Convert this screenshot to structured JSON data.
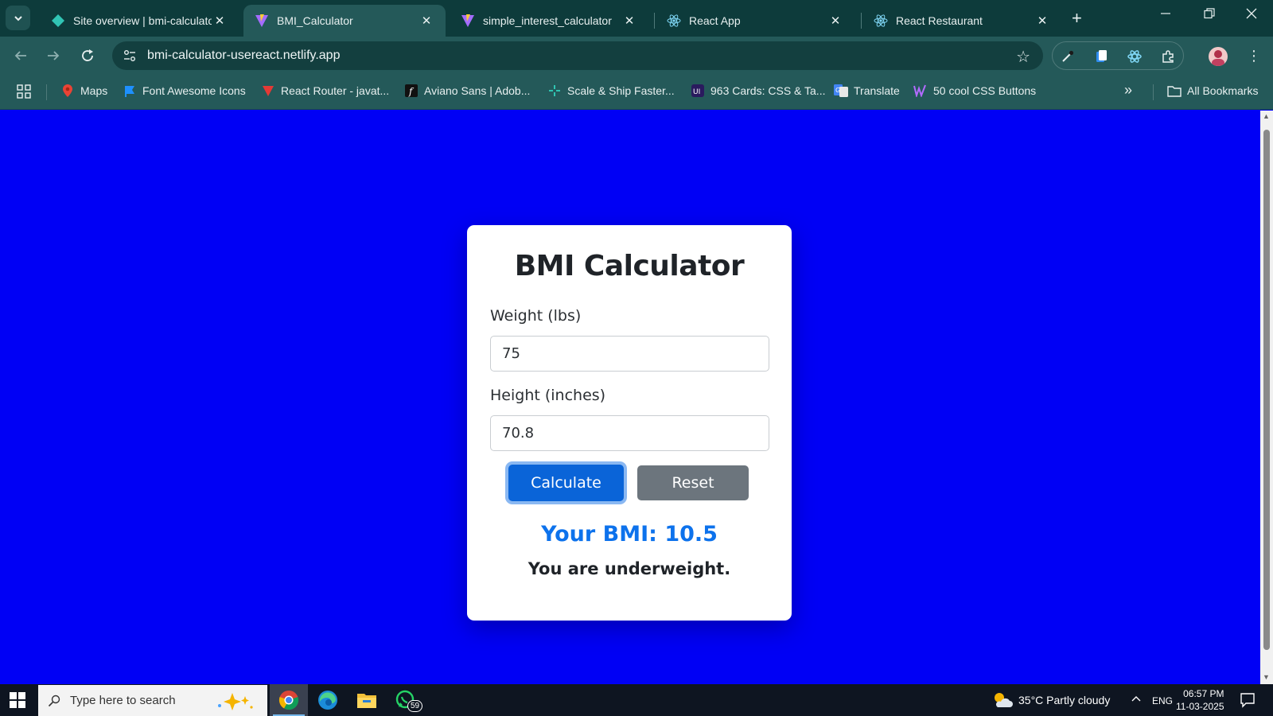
{
  "browser": {
    "tabs": [
      {
        "title": "Site overview | bmi-calculato",
        "icon": "netlify-icon",
        "active": false
      },
      {
        "title": "BMI_Calculator",
        "icon": "vite-icon",
        "active": true
      },
      {
        "title": "simple_interest_calculator",
        "icon": "vite-icon",
        "active": false
      },
      {
        "title": "React App",
        "icon": "react-icon",
        "active": false
      },
      {
        "title": "React Restaurant",
        "icon": "react-icon",
        "active": false
      }
    ],
    "new_tab": "+",
    "address": "bmi-calculator-usereact.netlify.app",
    "bookmarks": [
      {
        "label": "Maps",
        "icon": "maps-icon"
      },
      {
        "label": "Font Awesome Icons",
        "icon": "flag-icon"
      },
      {
        "label": "React Router - javat...",
        "icon": "react-router-icon"
      },
      {
        "label": "Aviano Sans | Adob...",
        "icon": "font-f-icon"
      },
      {
        "label": "Scale & Ship Faster...",
        "icon": "scale-icon"
      },
      {
        "label": "963 Cards: CSS & Ta...",
        "icon": "uiverse-icon"
      },
      {
        "label": "Translate",
        "icon": "translate-icon"
      },
      {
        "label": "50 cool CSS Buttons",
        "icon": "w-icon"
      }
    ],
    "more_bookmarks": "»",
    "all_bookmarks": "All Bookmarks"
  },
  "app": {
    "title": "BMI Calculator",
    "weight_label": "Weight (lbs)",
    "weight_value": "75",
    "height_label": "Height (inches)",
    "height_value": "70.8",
    "calculate_label": "Calculate",
    "reset_label": "Reset",
    "result_text": "Your BMI: 10.5",
    "status_text": "You are underweight."
  },
  "taskbar": {
    "search_placeholder": "Type here to search",
    "whatsapp_badge": "59",
    "weather": "35°C  Partly cloudy",
    "language": "ENG",
    "time": "06:57 PM",
    "date": "11-03-2025"
  },
  "colors": {
    "page_background": "#0000f5",
    "browser_chrome": "#245959",
    "tab_strip": "#0d3b3b",
    "calculate_button": "#0a64d8",
    "reset_button": "#6c757d",
    "result_text": "#0d72ec"
  }
}
